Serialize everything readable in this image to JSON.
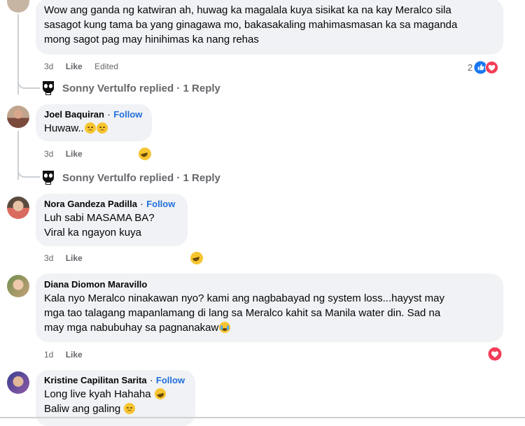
{
  "comments": [
    {
      "text_lines": [
        "Wow ang ganda ng katwiran ah, huwag ka magalala kuya sisikat ka na kay Meralco sila",
        "sasagot kung tama ba yang ginagawa mo, bakasakaling mahimasmasan ka sa maganda",
        "mong sagot pag may hinihimas ka nang rehas"
      ],
      "time": "3d",
      "like": "Like",
      "edited": "Edited",
      "reaction_count": "2"
    },
    {
      "author": "Joel Baquiran",
      "follow": "Follow",
      "separator": "·",
      "text": "Huwaw..",
      "time": "3d",
      "like": "Like"
    },
    {
      "author": "Nora Gandeza Padilla",
      "follow": "Follow",
      "separator": "·",
      "text_lines": [
        "Luh sabi MASAMA BA?",
        "Viral ka ngayon kuya"
      ],
      "time": "3d",
      "like": "Like"
    },
    {
      "author": "Diana Diomon Maravillo",
      "text_lines": [
        "Kala nyo Meralco ninakawan nyo? kami ang nagbabayad ng system loss...hayyst may",
        "mga tao talagang mapanlamang di lang sa Meralco kahit sa Manila water din. Sad na",
        "may mga nabubuhay sa pagnanakaw"
      ],
      "time": "1d",
      "like": "Like"
    },
    {
      "author": "Kristine Capilitan Sarita",
      "follow": "Follow",
      "separator": "·",
      "text_lines": [
        "Long live kyah Hahaha",
        "Baliw ang galing"
      ]
    }
  ],
  "replies": [
    {
      "label": "Sonny Vertulfo replied · 1 Reply"
    },
    {
      "label": "Sonny Vertulfo replied · 1 Reply"
    }
  ],
  "colors": {
    "link": "#216fdb",
    "bubble": "#f0f2f5",
    "meta": "#65676b",
    "like_blue": "#1877f2",
    "love_red": "#f33e58"
  },
  "icons": [
    "punisher-avatar-icon",
    "like-reaction-icon",
    "love-reaction-icon",
    "laugh-reaction-icon",
    "sad-emoji-icon",
    "crying-emoji-icon"
  ]
}
